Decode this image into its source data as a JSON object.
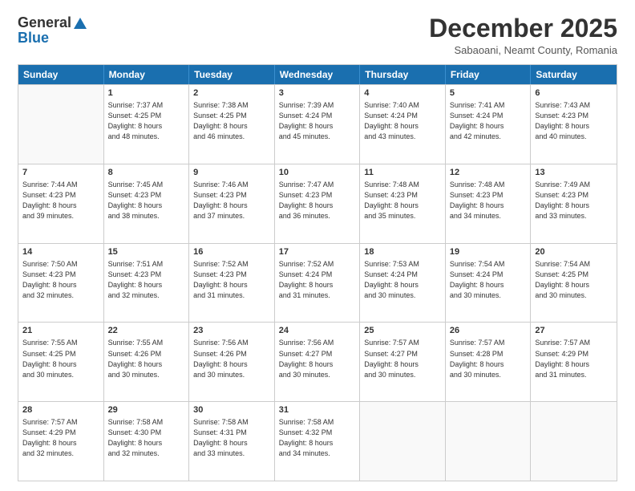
{
  "logo": {
    "general": "General",
    "blue": "Blue"
  },
  "title": "December 2025",
  "subtitle": "Sabaoani, Neamt County, Romania",
  "header_days": [
    "Sunday",
    "Monday",
    "Tuesday",
    "Wednesday",
    "Thursday",
    "Friday",
    "Saturday"
  ],
  "weeks": [
    [
      {
        "day": "",
        "info": ""
      },
      {
        "day": "1",
        "info": "Sunrise: 7:37 AM\nSunset: 4:25 PM\nDaylight: 8 hours\nand 48 minutes."
      },
      {
        "day": "2",
        "info": "Sunrise: 7:38 AM\nSunset: 4:25 PM\nDaylight: 8 hours\nand 46 minutes."
      },
      {
        "day": "3",
        "info": "Sunrise: 7:39 AM\nSunset: 4:24 PM\nDaylight: 8 hours\nand 45 minutes."
      },
      {
        "day": "4",
        "info": "Sunrise: 7:40 AM\nSunset: 4:24 PM\nDaylight: 8 hours\nand 43 minutes."
      },
      {
        "day": "5",
        "info": "Sunrise: 7:41 AM\nSunset: 4:24 PM\nDaylight: 8 hours\nand 42 minutes."
      },
      {
        "day": "6",
        "info": "Sunrise: 7:43 AM\nSunset: 4:23 PM\nDaylight: 8 hours\nand 40 minutes."
      }
    ],
    [
      {
        "day": "7",
        "info": "Sunrise: 7:44 AM\nSunset: 4:23 PM\nDaylight: 8 hours\nand 39 minutes."
      },
      {
        "day": "8",
        "info": "Sunrise: 7:45 AM\nSunset: 4:23 PM\nDaylight: 8 hours\nand 38 minutes."
      },
      {
        "day": "9",
        "info": "Sunrise: 7:46 AM\nSunset: 4:23 PM\nDaylight: 8 hours\nand 37 minutes."
      },
      {
        "day": "10",
        "info": "Sunrise: 7:47 AM\nSunset: 4:23 PM\nDaylight: 8 hours\nand 36 minutes."
      },
      {
        "day": "11",
        "info": "Sunrise: 7:48 AM\nSunset: 4:23 PM\nDaylight: 8 hours\nand 35 minutes."
      },
      {
        "day": "12",
        "info": "Sunrise: 7:48 AM\nSunset: 4:23 PM\nDaylight: 8 hours\nand 34 minutes."
      },
      {
        "day": "13",
        "info": "Sunrise: 7:49 AM\nSunset: 4:23 PM\nDaylight: 8 hours\nand 33 minutes."
      }
    ],
    [
      {
        "day": "14",
        "info": "Sunrise: 7:50 AM\nSunset: 4:23 PM\nDaylight: 8 hours\nand 32 minutes."
      },
      {
        "day": "15",
        "info": "Sunrise: 7:51 AM\nSunset: 4:23 PM\nDaylight: 8 hours\nand 32 minutes."
      },
      {
        "day": "16",
        "info": "Sunrise: 7:52 AM\nSunset: 4:23 PM\nDaylight: 8 hours\nand 31 minutes."
      },
      {
        "day": "17",
        "info": "Sunrise: 7:52 AM\nSunset: 4:24 PM\nDaylight: 8 hours\nand 31 minutes."
      },
      {
        "day": "18",
        "info": "Sunrise: 7:53 AM\nSunset: 4:24 PM\nDaylight: 8 hours\nand 30 minutes."
      },
      {
        "day": "19",
        "info": "Sunrise: 7:54 AM\nSunset: 4:24 PM\nDaylight: 8 hours\nand 30 minutes."
      },
      {
        "day": "20",
        "info": "Sunrise: 7:54 AM\nSunset: 4:25 PM\nDaylight: 8 hours\nand 30 minutes."
      }
    ],
    [
      {
        "day": "21",
        "info": "Sunrise: 7:55 AM\nSunset: 4:25 PM\nDaylight: 8 hours\nand 30 minutes."
      },
      {
        "day": "22",
        "info": "Sunrise: 7:55 AM\nSunset: 4:26 PM\nDaylight: 8 hours\nand 30 minutes."
      },
      {
        "day": "23",
        "info": "Sunrise: 7:56 AM\nSunset: 4:26 PM\nDaylight: 8 hours\nand 30 minutes."
      },
      {
        "day": "24",
        "info": "Sunrise: 7:56 AM\nSunset: 4:27 PM\nDaylight: 8 hours\nand 30 minutes."
      },
      {
        "day": "25",
        "info": "Sunrise: 7:57 AM\nSunset: 4:27 PM\nDaylight: 8 hours\nand 30 minutes."
      },
      {
        "day": "26",
        "info": "Sunrise: 7:57 AM\nSunset: 4:28 PM\nDaylight: 8 hours\nand 30 minutes."
      },
      {
        "day": "27",
        "info": "Sunrise: 7:57 AM\nSunset: 4:29 PM\nDaylight: 8 hours\nand 31 minutes."
      }
    ],
    [
      {
        "day": "28",
        "info": "Sunrise: 7:57 AM\nSunset: 4:29 PM\nDaylight: 8 hours\nand 32 minutes."
      },
      {
        "day": "29",
        "info": "Sunrise: 7:58 AM\nSunset: 4:30 PM\nDaylight: 8 hours\nand 32 minutes."
      },
      {
        "day": "30",
        "info": "Sunrise: 7:58 AM\nSunset: 4:31 PM\nDaylight: 8 hours\nand 33 minutes."
      },
      {
        "day": "31",
        "info": "Sunrise: 7:58 AM\nSunset: 4:32 PM\nDaylight: 8 hours\nand 34 minutes."
      },
      {
        "day": "",
        "info": ""
      },
      {
        "day": "",
        "info": ""
      },
      {
        "day": "",
        "info": ""
      }
    ]
  ]
}
